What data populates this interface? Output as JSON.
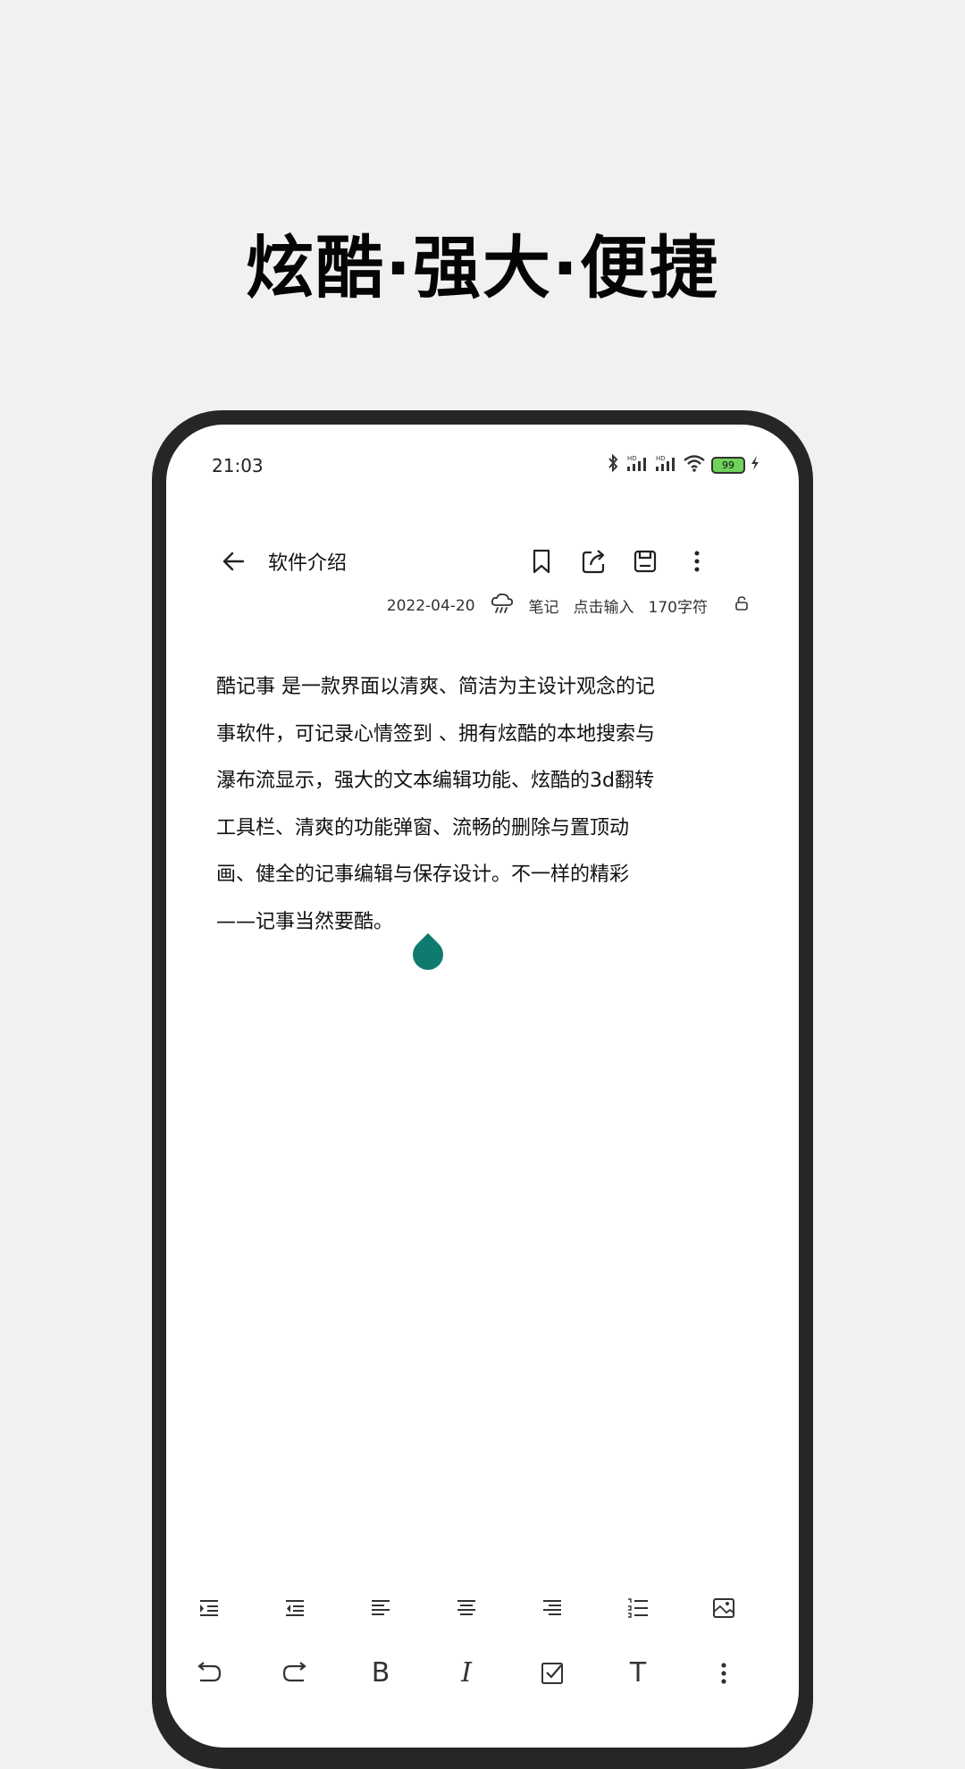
{
  "headline": "炫酷·强大·便捷",
  "status_bar": {
    "time": "21:03",
    "battery": "99",
    "icons": [
      "bluetooth-icon",
      "signal-hd-icon",
      "signal-hd-icon",
      "wifi-icon",
      "battery-icon",
      "charging-icon"
    ]
  },
  "note": {
    "title": "软件介绍",
    "date": "2022-04-20",
    "weather_icon": "rain-cloud-icon",
    "category": "笔记",
    "location": "点击输入",
    "char_count": "170字符",
    "content": [
      "酷记事 是一款界面以清爽、简洁为主设计观念的记",
      "事软件，可记录心情签到 、拥有炫酷的本地搜索与",
      "瀑布流显示，强大的文本编辑功能、炫酷的3d翻转",
      "工具栏、清爽的功能弹窗、流畅的删除与置顶动",
      "画、健全的记事编辑与保存设计。不一样的精彩",
      "——记事当然要酷。"
    ]
  },
  "top_actions": [
    "bookmark-icon",
    "share-icon",
    "save-icon",
    "more-icon"
  ],
  "format_toolbar": {
    "row1": [
      "indent-increase-icon",
      "indent-decrease-icon",
      "align-left-icon",
      "align-center-icon",
      "align-right-icon",
      "numbered-list-icon",
      "insert-image-icon"
    ],
    "row2_text": {
      "bold": "B",
      "italic": "I",
      "text_size": "T"
    }
  },
  "colors": {
    "accent": "#0f7b6e",
    "frame": "#262626",
    "background": "#f1f1f1"
  }
}
